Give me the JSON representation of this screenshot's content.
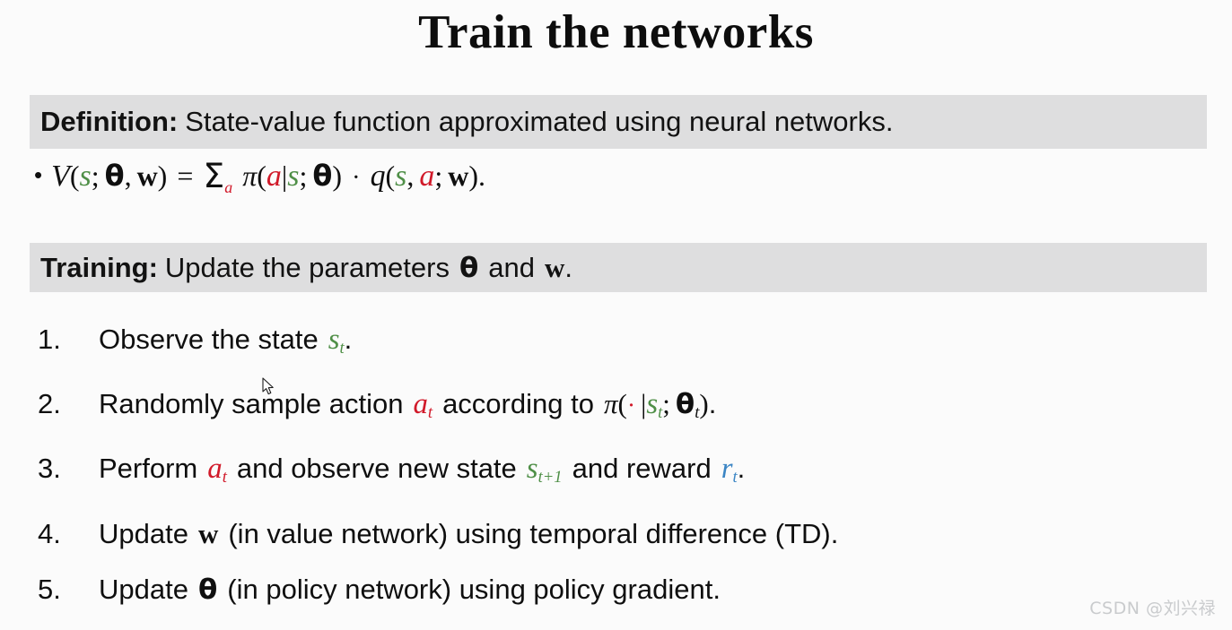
{
  "slide": {
    "title": "Train the networks",
    "background_color": "#fbfbfb",
    "banner_color": "#dededf",
    "accent_colors": {
      "state_green": "#4f8f47",
      "action_red": "#d11a2a",
      "reward_blue": "#3b85c4",
      "text_black": "#0f0f0f"
    }
  },
  "definition": {
    "lead": "Definition:",
    "text": "State-value function approximated using neural networks.",
    "formula_plain": "V(s; θ, w) = Σ_a π(a|s; θ) · q(s, a; w).",
    "tokens": {
      "bullet": "•",
      "V": "V",
      "s": "s",
      "theta": "θ",
      "w": "w",
      "equals": "=",
      "sigma": "Σ",
      "a": "a",
      "pi": "π",
      "bar": "|",
      "cdot": "·",
      "q": "q",
      "comma": ",",
      "semicolon": ";",
      "lparen": "(",
      "rparen": ")",
      "period": "."
    }
  },
  "training": {
    "lead": "Training:",
    "text_before_theta": "Update the parameters",
    "theta": "θ",
    "text_and": "and",
    "w": "w",
    "period": "."
  },
  "steps": [
    {
      "number": "1.",
      "plain": "Observe the state s_t.",
      "parts": {
        "p1": "Observe the state",
        "sym_s": "s",
        "sub_t": "t",
        "end": "."
      }
    },
    {
      "number": "2.",
      "plain": "Randomly sample action a_t according to π( · |s_t; θ_t).",
      "parts": {
        "p1": "Randomly sample action",
        "sym_a": "a",
        "sub_t": "t",
        "p2": "according to",
        "pi": "π",
        "lparen": "(",
        "cdot": "·",
        "bar": "|",
        "sym_s": "s",
        "semicolon": ";",
        "theta": "θ",
        "rparen": ")",
        "end": "."
      }
    },
    {
      "number": "3.",
      "plain": "Perform a_t and observe new state s_{t+1} and reward r_t.",
      "parts": {
        "p1": "Perform",
        "sym_a": "a",
        "sub_t": "t",
        "p2": "and observe new state",
        "sym_s": "s",
        "sub_t1": "t+1",
        "p3": "and reward",
        "sym_r": "r",
        "end": "."
      }
    },
    {
      "number": "4.",
      "plain": "Update w (in value network) using temporal difference (TD).",
      "parts": {
        "p1": "Update",
        "w": "w",
        "p2": "(in value network) using temporal difference (TD)."
      }
    },
    {
      "number": "5.",
      "plain": "Update θ (in policy network) using policy gradient.",
      "parts": {
        "p1": "Update",
        "theta": "θ",
        "p2": "(in policy network) using policy gradient."
      }
    }
  ],
  "watermark": {
    "text": "CSDN @刘兴禄"
  }
}
